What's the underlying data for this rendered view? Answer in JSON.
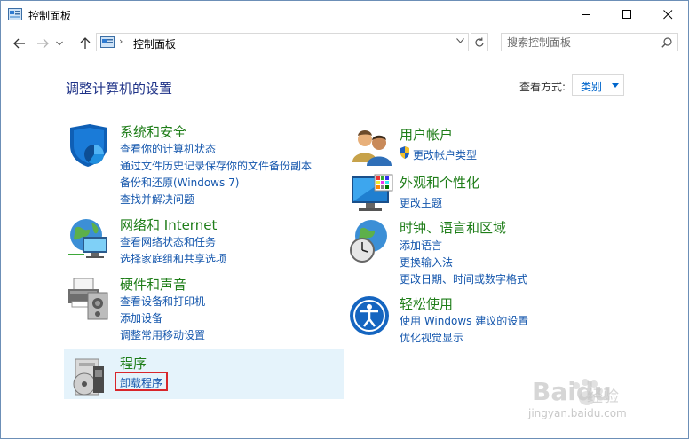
{
  "window": {
    "title": "控制面板"
  },
  "address": {
    "crumb": "控制面板",
    "search_placeholder": "搜索控制面板"
  },
  "main": {
    "heading": "调整计算机的设置",
    "view_by_label": "查看方式:",
    "view_by_value": "类别"
  },
  "categories": [
    {
      "title": "系统和安全",
      "links": [
        "查看你的计算机状态",
        "通过文件历史记录保存你的文件备份副本",
        "备份和还原(Windows 7)",
        "查找并解决问题"
      ]
    },
    {
      "title": "网络和 Internet",
      "links": [
        "查看网络状态和任务",
        "选择家庭组和共享选项"
      ]
    },
    {
      "title": "硬件和声音",
      "links": [
        "查看设备和打印机",
        "添加设备",
        "调整常用移动设置"
      ]
    },
    {
      "title": "程序",
      "links": [
        "卸载程序"
      ]
    },
    {
      "title": "用户帐户",
      "links": [
        "更改帐户类型"
      ]
    },
    {
      "title": "外观和个性化",
      "links": [
        "更改主题"
      ]
    },
    {
      "title": "时钟、语言和区域",
      "links": [
        "添加语言",
        "更换输入法",
        "更改日期、时间或数字格式"
      ]
    },
    {
      "title": "轻松使用",
      "links": [
        "使用 Windows 建议的设置",
        "优化视觉显示"
      ]
    }
  ],
  "watermark": {
    "brand": "Baidu",
    "sub": "经验",
    "url": "jingyan.baidu.com"
  },
  "colors": {
    "category_title": "#1e7d18",
    "link": "#1557ad",
    "heading": "#1e3287",
    "highlight_box": "#d8262b",
    "hover": "#e5f3fb"
  }
}
